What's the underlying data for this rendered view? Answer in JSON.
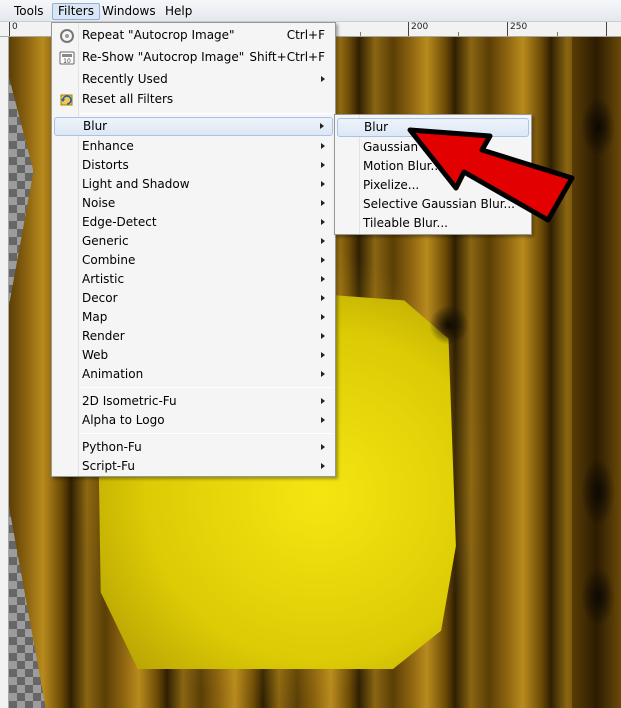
{
  "menubar": {
    "items": [
      {
        "label": "Tools"
      },
      {
        "label": "Filters"
      },
      {
        "label": "Windows"
      },
      {
        "label": "Help"
      }
    ]
  },
  "ruler": {
    "labels": [
      "0",
      "200",
      "250"
    ]
  },
  "filters_menu": {
    "repeat": {
      "label": "Repeat \"Autocrop Image\"",
      "shortcut": "Ctrl+F",
      "icon": "repeat-icon"
    },
    "reshow": {
      "label": "Re-Show \"Autocrop Image\"",
      "shortcut": "Shift+Ctrl+F",
      "icon": "reshow-icon"
    },
    "recently_used": {
      "label": "Recently Used"
    },
    "reset": {
      "label": "Reset all Filters",
      "icon": "reset-filters-icon"
    },
    "groups": [
      "Blur",
      "Enhance",
      "Distorts",
      "Light and Shadow",
      "Noise",
      "Edge-Detect",
      "Generic",
      "Combine",
      "Artistic",
      "Decor",
      "Map",
      "Render",
      "Web",
      "Animation"
    ],
    "scripts": [
      "2D Isometric-Fu",
      "Alpha to Logo"
    ],
    "fu": [
      "Python-Fu",
      "Script-Fu"
    ]
  },
  "blur_submenu": {
    "items": [
      "Blur",
      "Gaussian Blur...",
      "Motion Blur...",
      "Pixelize...",
      "Selective Gaussian Blur...",
      "Tileable Blur..."
    ]
  },
  "colors": {
    "highlight": "#dde8f6",
    "arrow": "#e30000"
  }
}
